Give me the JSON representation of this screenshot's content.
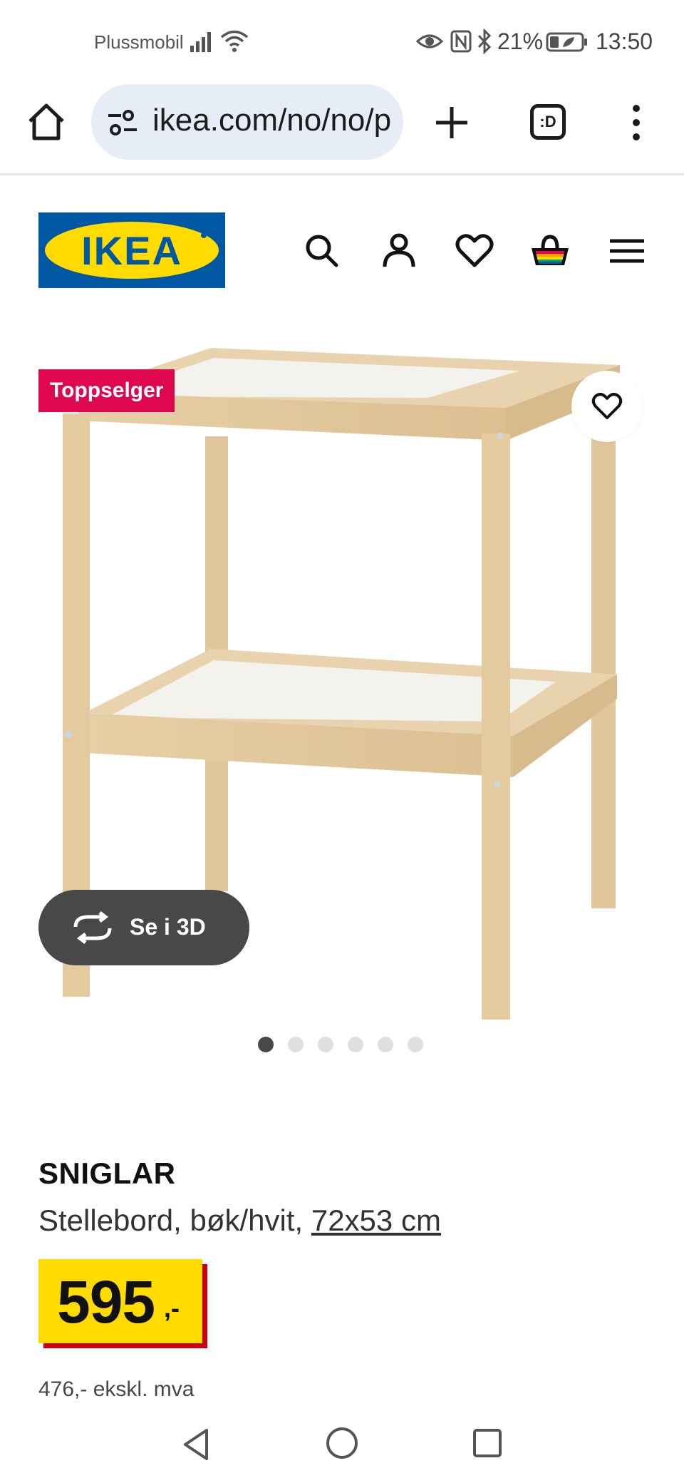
{
  "status_bar": {
    "carrier": "Plussmobil",
    "battery_percent": "21%",
    "time": "13:50"
  },
  "browser": {
    "url": "ikea.com/no/no/p",
    "tabs_label": ":D"
  },
  "product": {
    "badge": "Toppselger",
    "see_3d_label": "Se i 3D",
    "name": "SNIGLAR",
    "description": "Stellebord, bøk/hvit, ",
    "dimensions": "72x53 cm",
    "price_integer": "595",
    "price_suffix": ",-",
    "price_ex_vat": "476,- ekskl. mva",
    "image_count": 6,
    "active_image_index": 1
  },
  "colors": {
    "ikea_blue": "#0058a3",
    "ikea_yellow": "#ffdb00",
    "badge_red": "#e00751",
    "price_shadow_red": "#cc0008"
  },
  "icons": {
    "header": [
      "search-icon",
      "account-icon",
      "heart-icon",
      "basket-icon",
      "hamburger-menu-icon"
    ],
    "browser": [
      "home-icon",
      "site-settings-icon",
      "new-tab-plus-icon",
      "tabs-icon",
      "overflow-menu-icon"
    ],
    "nav": [
      "back-icon",
      "home-circle-icon",
      "recents-icon"
    ]
  }
}
